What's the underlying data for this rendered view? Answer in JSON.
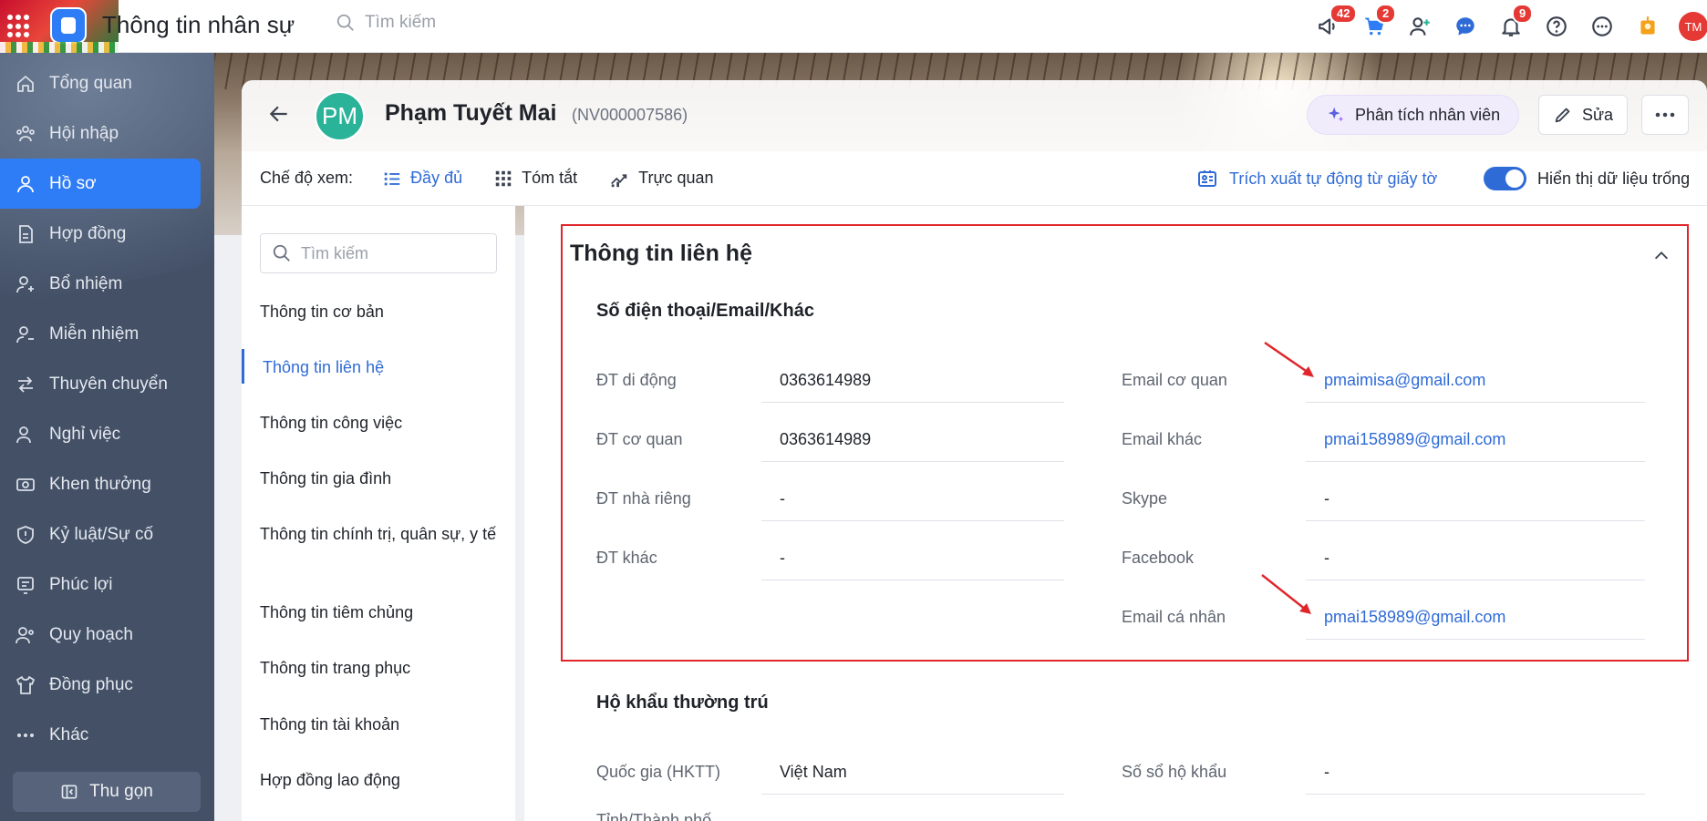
{
  "app": {
    "title": "Thông tin nhân sự",
    "search_placeholder": "Tìm kiếm"
  },
  "topbar": {
    "badges": {
      "announce": "42",
      "cart": "2",
      "bell": "9"
    },
    "avatar_initials": "TM"
  },
  "sidebar": {
    "items": [
      {
        "label": "Tổng quan",
        "icon": "home-icon"
      },
      {
        "label": "Hội nhập",
        "icon": "onboarding-icon"
      },
      {
        "label": "Hồ sơ",
        "icon": "profile-icon",
        "active": true
      },
      {
        "label": "Hợp đồng",
        "icon": "document-icon"
      },
      {
        "label": "Bổ nhiệm",
        "icon": "user-plus-icon"
      },
      {
        "label": "Miễn nhiệm",
        "icon": "user-minus-icon"
      },
      {
        "label": "Thuyên chuyển",
        "icon": "transfer-icon"
      },
      {
        "label": "Nghỉ việc",
        "icon": "user-leave-icon"
      },
      {
        "label": "Khen thưởng",
        "icon": "reward-icon"
      },
      {
        "label": "Kỷ luật/Sự cố",
        "icon": "shield-icon"
      },
      {
        "label": "Phúc lợi",
        "icon": "benefit-icon"
      },
      {
        "label": "Quy hoạch",
        "icon": "planning-icon"
      },
      {
        "label": "Đồng phục",
        "icon": "shirt-icon"
      },
      {
        "label": "Khác",
        "icon": "more-dots-icon"
      }
    ],
    "collapse_label": "Thu gọn"
  },
  "employee": {
    "initials": "PM",
    "name": "Phạm Tuyết Mai",
    "code": "(NV000007586)",
    "analyze_label": "Phân tích nhân viên",
    "edit_label": "Sửa"
  },
  "viewbar": {
    "label": "Chế độ xem:",
    "options": [
      "Đầy đủ",
      "Tóm tắt",
      "Trực quan"
    ],
    "active_option": "Đầy đủ",
    "extract_label": "Trích xuất tự động từ giấy tờ",
    "toggle_label": "Hiển thị dữ liệu trống",
    "toggle_on": true
  },
  "section_nav": {
    "search_placeholder": "Tìm kiếm",
    "items": [
      "Thông tin cơ bản",
      "Thông tin liên hệ",
      "Thông tin công việc",
      "Thông tin gia đình",
      "Thông tin chính trị, quân sự, y tế",
      "Thông tin tiêm chủng",
      "Thông tin trang phục",
      "Thông tin tài khoản",
      "Hợp đồng lao động"
    ],
    "active_item": "Thông tin liên hệ"
  },
  "contact": {
    "title": "Thông tin liên hệ",
    "subtitle": "Số điện thoại/Email/Khác",
    "left_fields": [
      {
        "label": "ĐT di động",
        "value": "0363614989"
      },
      {
        "label": "ĐT cơ quan",
        "value": "0363614989"
      },
      {
        "label": "ĐT nhà riêng",
        "value": "-"
      },
      {
        "label": "ĐT khác",
        "value": "-"
      }
    ],
    "right_fields": [
      {
        "label": "Email cơ quan",
        "value": "pmaimisa@gmail.com",
        "link": true
      },
      {
        "label": "Email khác",
        "value": "pmai158989@gmail.com",
        "link": true
      },
      {
        "label": "Skype",
        "value": "-"
      },
      {
        "label": "Facebook",
        "value": "-"
      },
      {
        "label": "Email cá nhân",
        "value": "pmai158989@gmail.com",
        "link": true
      }
    ]
  },
  "household": {
    "subtitle": "Hộ khẩu thường trú",
    "fields": [
      {
        "label": "Quốc gia (HKTT)",
        "value": "Việt Nam"
      },
      {
        "label": "Số sổ hộ khẩu",
        "value": "-"
      },
      {
        "label": "Tỉnh/Thành phố"
      }
    ]
  },
  "colors": {
    "accent": "#2f6bd6",
    "sidebar_bg": "#435066",
    "highlight_red": "#e0262b",
    "avatar_green": "#2bb39a"
  }
}
